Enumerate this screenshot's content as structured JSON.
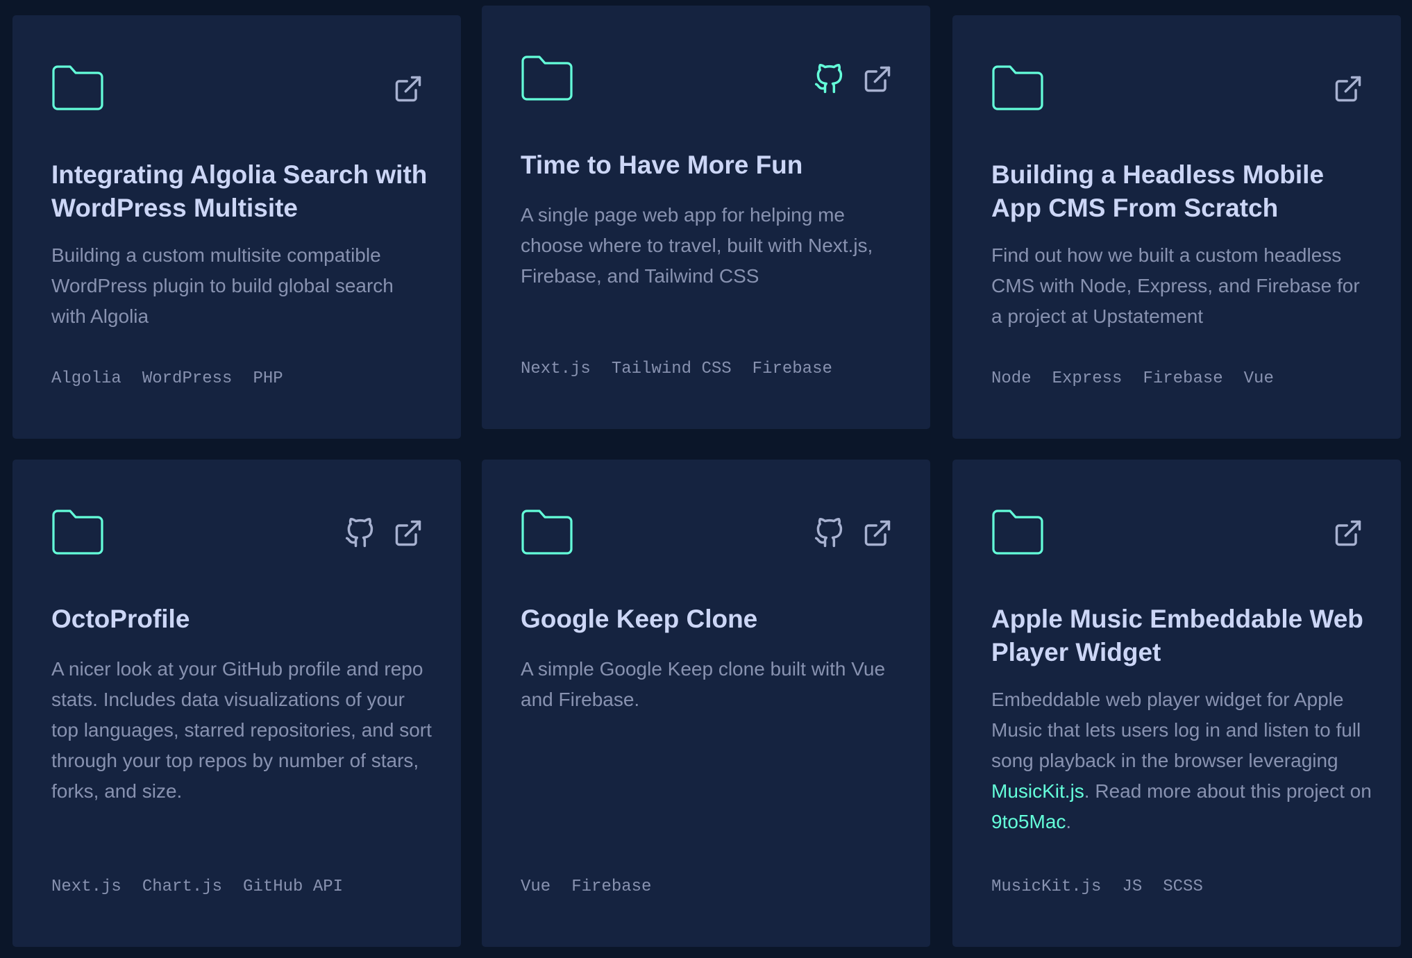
{
  "colors": {
    "background": "#0b1629",
    "card": "#152340",
    "accent": "#64ffda",
    "title": "#ccd6f6",
    "text": "#8892b0"
  },
  "projects": [
    {
      "title": "Integrating Algolia Search with WordPress Multisite",
      "description": "Building a custom multisite compatible WordPress plugin to build global search with Algolia",
      "tags": [
        "Algolia",
        "WordPress",
        "PHP"
      ],
      "icons": [
        "folder-icon",
        "external-link-icon"
      ]
    },
    {
      "title": "Time to Have More Fun",
      "description": "A single page web app for helping me choose where to travel, built with Next.js, Firebase, and Tailwind CSS",
      "tags": [
        "Next.js",
        "Tailwind CSS",
        "Firebase"
      ],
      "icons": [
        "folder-icon",
        "github-icon",
        "external-link-icon"
      ]
    },
    {
      "title": "Building a Headless Mobile App CMS From Scratch",
      "description": "Find out how we built a custom headless CMS with Node, Express, and Firebase for a project at Upstatement",
      "tags": [
        "Node",
        "Express",
        "Firebase",
        "Vue"
      ],
      "icons": [
        "folder-icon",
        "external-link-icon"
      ]
    },
    {
      "title": "OctoProfile",
      "description": "A nicer look at your GitHub profile and repo stats. Includes data visualizations of your top languages, starred repositories, and sort through your top repos by number of stars, forks, and size.",
      "tags": [
        "Next.js",
        "Chart.js",
        "GitHub API"
      ],
      "icons": [
        "folder-icon",
        "github-icon",
        "external-link-icon"
      ]
    },
    {
      "title": "Google Keep Clone",
      "description": "A simple Google Keep clone built with Vue and Firebase.",
      "tags": [
        "Vue",
        "Firebase"
      ],
      "icons": [
        "folder-icon",
        "github-icon",
        "external-link-icon"
      ]
    },
    {
      "title": "Apple Music Embeddable Web Player Widget",
      "description_parts": {
        "p1": "Embeddable web player widget for Apple Music that lets users log in and listen to full song playback in the browser leveraging ",
        "link1": "MusicKit.js",
        "p2": ". Read more about this project on ",
        "link2": "9to5Mac",
        "p3": "."
      },
      "tags": [
        "MusicKit.js",
        "JS",
        "SCSS"
      ],
      "icons": [
        "folder-icon",
        "external-link-icon"
      ]
    }
  ]
}
